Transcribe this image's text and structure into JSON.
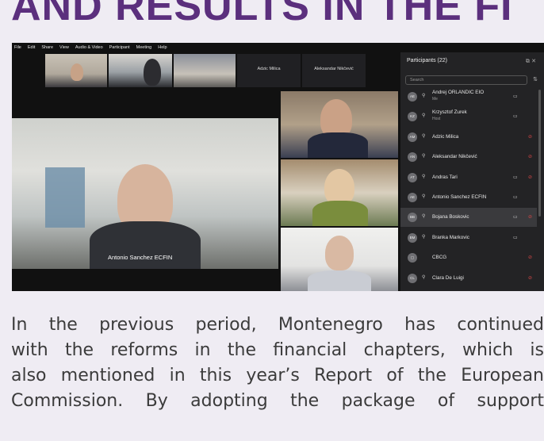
{
  "headline": "AND RESULTS IN THE FI",
  "menu": [
    "File",
    "Edit",
    "Share",
    "View",
    "Audio & Video",
    "Participant",
    "Meeting",
    "Help"
  ],
  "tiles": {
    "t4": "Adzic Milica",
    "t5": "Aleksandar Nikčević"
  },
  "main_video_label": "Antonio Sanchez ECFIN",
  "panel": {
    "title": "Participants (22)",
    "controls": "⧉ ✕",
    "search_placeholder": "Search",
    "participants": [
      {
        "initials": "AE",
        "name": "Andrej ORLANDIC EIO",
        "role": "Me",
        "cam": true,
        "muted": false
      },
      {
        "initials": "KZ",
        "name": "Krzysztof Zurek",
        "role": "Host",
        "cam": true,
        "muted": false
      },
      {
        "initials": "AM",
        "name": "Adzic Milica",
        "role": "",
        "cam": false,
        "muted": true
      },
      {
        "initials": "AN",
        "name": "Aleksandar Nikčević",
        "role": "",
        "cam": false,
        "muted": true
      },
      {
        "initials": "AT",
        "name": "Andras Tari",
        "role": "",
        "cam": true,
        "muted": true
      },
      {
        "initials": "AE",
        "name": "Antonio Sanchez ECFIN",
        "role": "",
        "cam": true,
        "muted": false
      },
      {
        "initials": "BB",
        "name": "Bojana Boskovic",
        "role": "",
        "cam": true,
        "muted": true
      },
      {
        "initials": "BM",
        "name": "Branka Markovic",
        "role": "",
        "cam": true,
        "muted": false
      },
      {
        "initials": "",
        "name": "CBCG",
        "role": "",
        "cam": false,
        "muted": true
      },
      {
        "initials": "CL",
        "name": "Clara De Luigi",
        "role": "",
        "cam": false,
        "muted": true
      }
    ]
  },
  "body_lines": [
    "In the previous period, Montenegro has continued",
    "with the reforms in the financial chapters, which is",
    "also mentioned in this year’s Report of the European",
    "Commission. By adopting the package of support"
  ],
  "colors": {
    "headline": "#5b2f7d",
    "page_bg": "#efecf3",
    "panel_bg": "#232325"
  }
}
